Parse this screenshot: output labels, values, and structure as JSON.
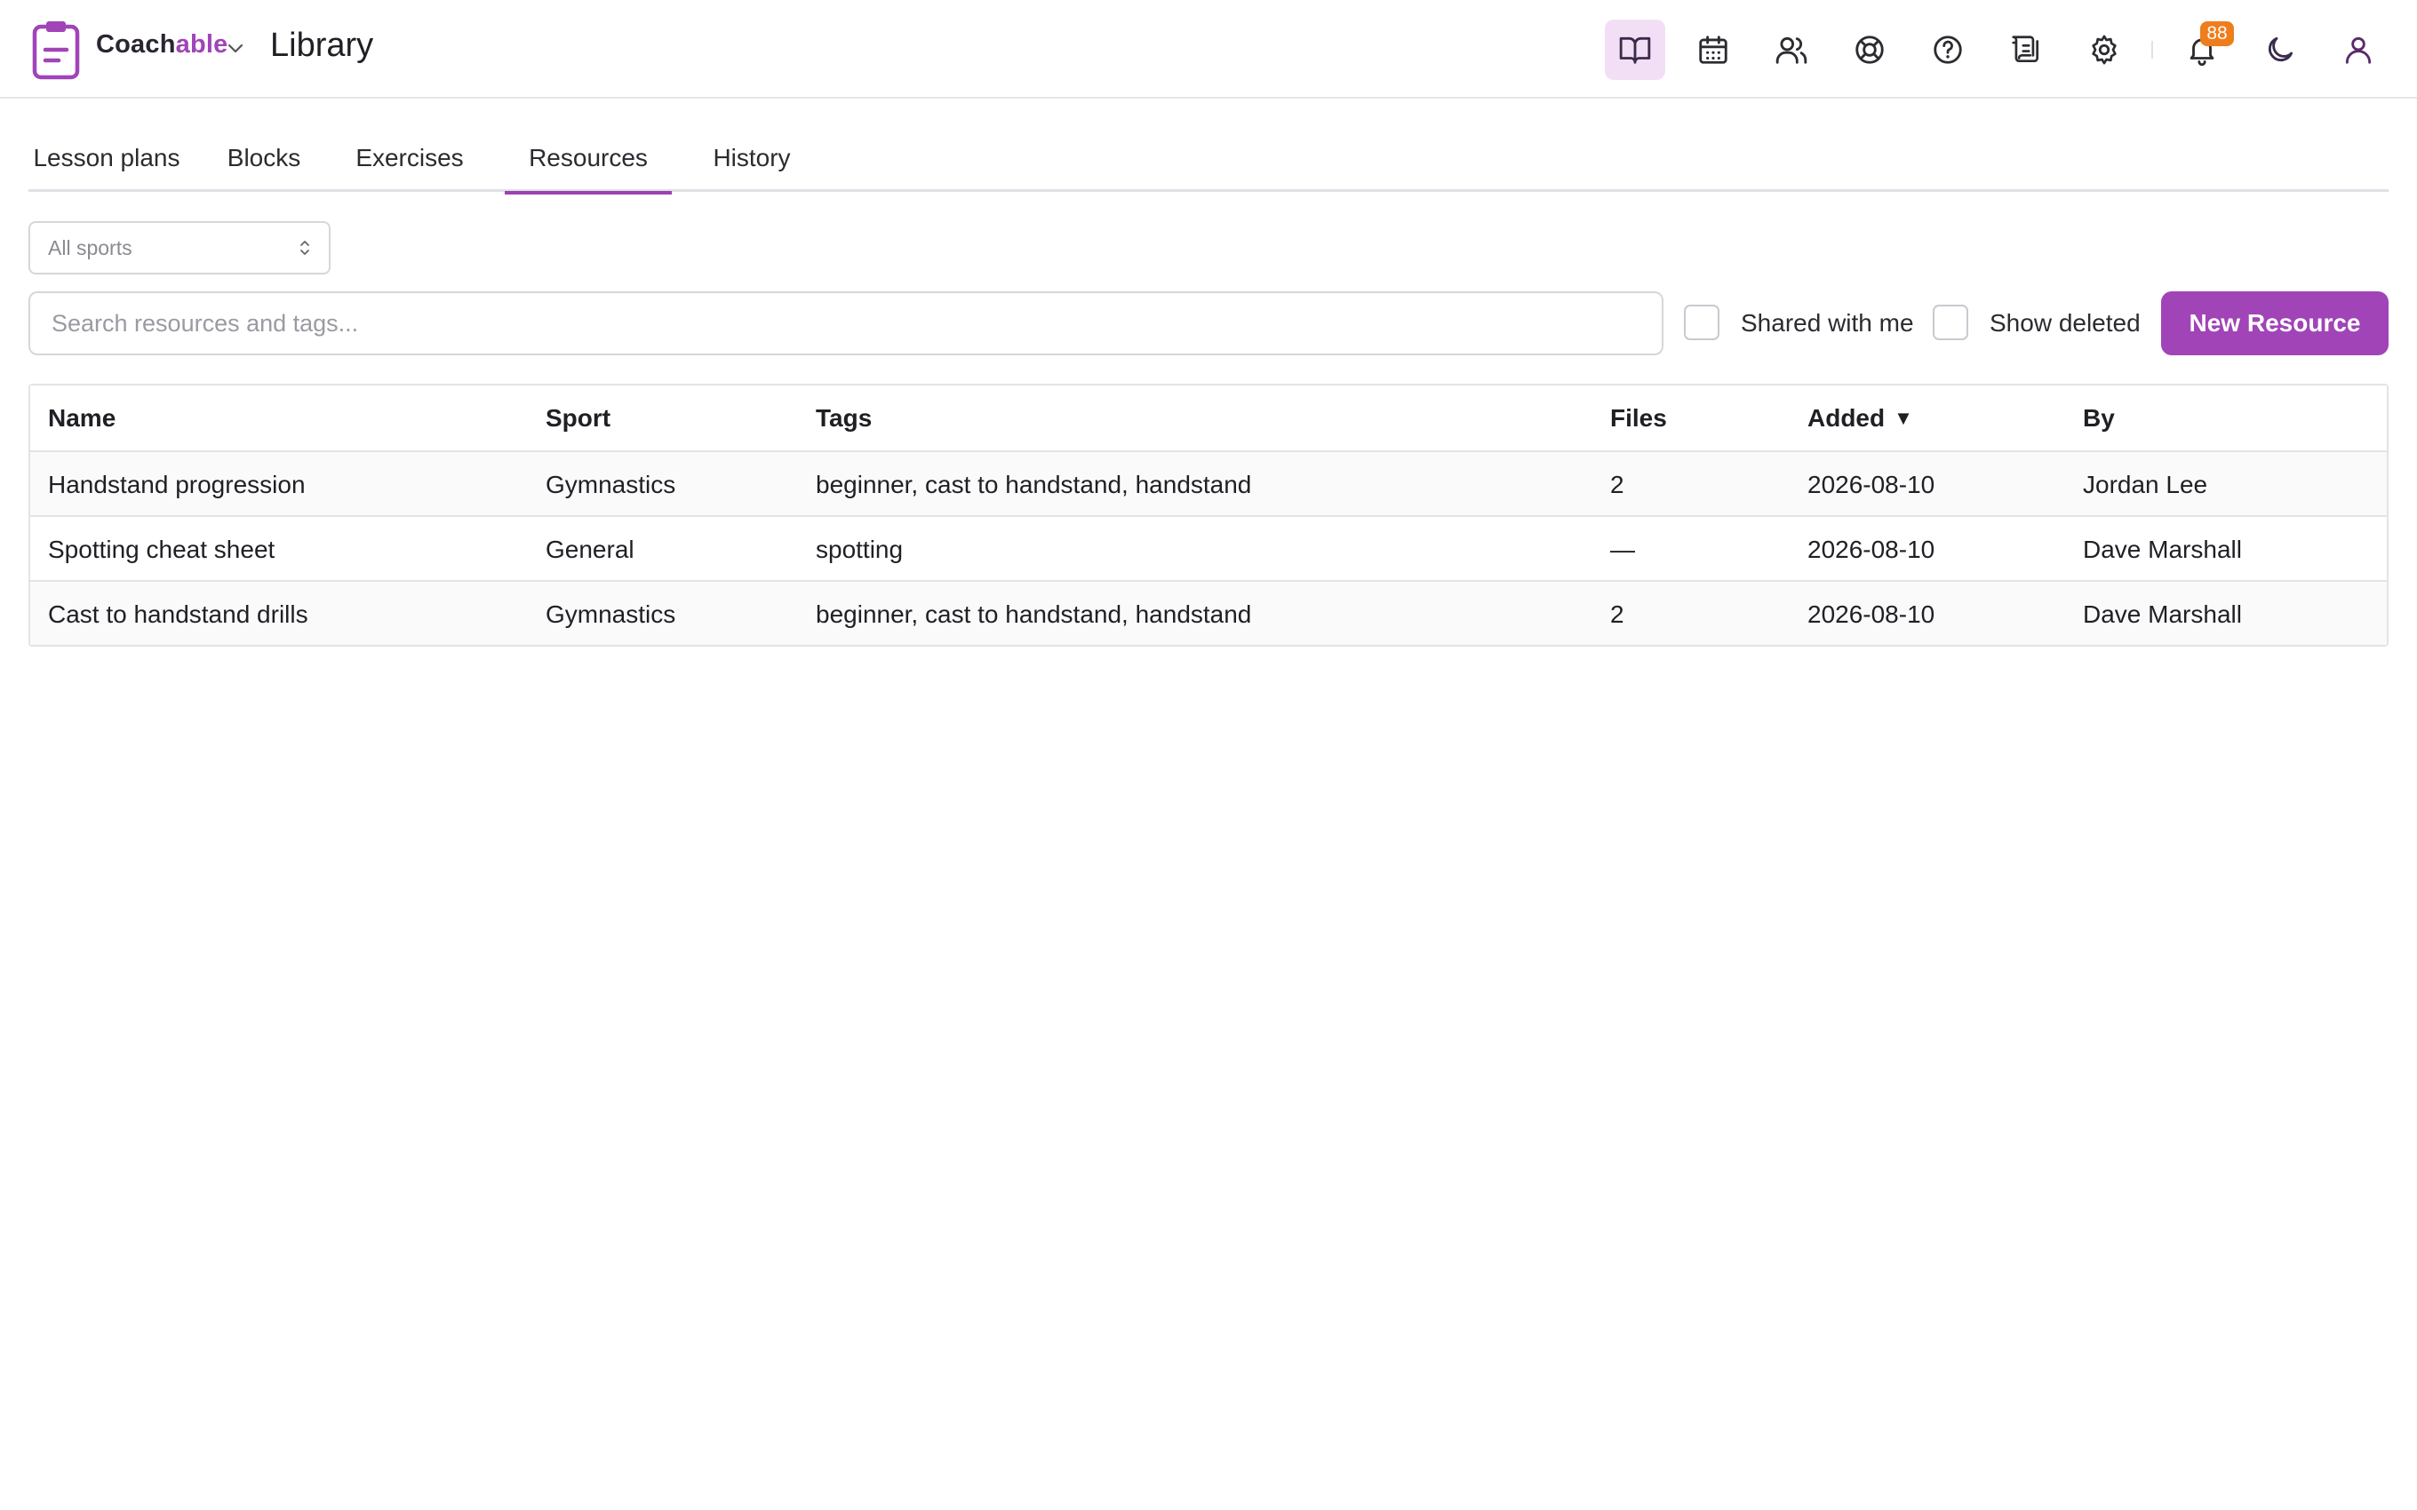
{
  "app": {
    "brand_part1": "Coach",
    "brand_part2": "able",
    "page_title": "Library",
    "notification_count": "88",
    "accent_color": "#a044b8",
    "badge_color": "#ef7d1c"
  },
  "header_icons": [
    {
      "name": "library-book-icon",
      "active": true
    },
    {
      "name": "calendar-icon",
      "active": false
    },
    {
      "name": "people-icon",
      "active": false
    },
    {
      "name": "lifebuoy-icon",
      "active": false
    },
    {
      "name": "help-icon",
      "active": false
    },
    {
      "name": "scroll-icon",
      "active": false
    },
    {
      "name": "settings-gear-icon",
      "active": false
    },
    {
      "name": "bell-icon",
      "active": false
    },
    {
      "name": "moon-icon",
      "active": false
    },
    {
      "name": "user-icon",
      "active": false
    }
  ],
  "tabs": [
    {
      "label": "Lesson plans",
      "active": false
    },
    {
      "label": "Blocks",
      "active": false
    },
    {
      "label": "Exercises",
      "active": false
    },
    {
      "label": "Resources",
      "active": true
    },
    {
      "label": "History",
      "active": false
    }
  ],
  "filters": {
    "sport_select": "All sports",
    "search_placeholder": "Search resources and tags...",
    "shared_with_me": "Shared with me",
    "shared_with_me_checked": false,
    "show_deleted": "Show deleted",
    "show_deleted_checked": false,
    "new_button": "New Resource"
  },
  "table": {
    "columns": [
      "Name",
      "Sport",
      "Tags",
      "Files",
      "Added",
      "By"
    ],
    "sorted_column": "Added",
    "sort_indicator": "▼",
    "rows": [
      [
        "Handstand progression",
        "Gymnastics",
        "beginner, cast to handstand, handstand",
        "2",
        "2026-08-10",
        "Jordan Lee"
      ],
      [
        "Spotting cheat sheet",
        "General",
        "spotting",
        "—",
        "2026-08-10",
        "Dave Marshall"
      ],
      [
        "Cast to handstand drills",
        "Gymnastics",
        "beginner, cast to handstand, handstand",
        "2",
        "2026-08-10",
        "Dave Marshall"
      ]
    ]
  }
}
